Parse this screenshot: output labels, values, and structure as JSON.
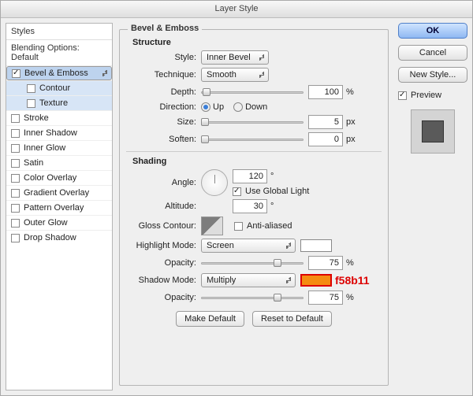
{
  "window": {
    "title": "Layer Style"
  },
  "left": {
    "header": "Styles",
    "blending": "Blending Options: Default",
    "items": [
      {
        "label": "Bevel & Emboss",
        "checked": true,
        "selected": true
      },
      {
        "label": "Contour",
        "checked": false,
        "child": true,
        "childsel": true
      },
      {
        "label": "Texture",
        "checked": false,
        "child": true,
        "childsel": true
      },
      {
        "label": "Stroke",
        "checked": false
      },
      {
        "label": "Inner Shadow",
        "checked": false
      },
      {
        "label": "Inner Glow",
        "checked": false
      },
      {
        "label": "Satin",
        "checked": false
      },
      {
        "label": "Color Overlay",
        "checked": false
      },
      {
        "label": "Gradient Overlay",
        "checked": false
      },
      {
        "label": "Pattern Overlay",
        "checked": false
      },
      {
        "label": "Outer Glow",
        "checked": false
      },
      {
        "label": "Drop Shadow",
        "checked": false
      }
    ]
  },
  "panel": {
    "title": "Bevel & Emboss",
    "structure": {
      "heading": "Structure",
      "style_label": "Style:",
      "style_value": "Inner Bevel",
      "technique_label": "Technique:",
      "technique_value": "Smooth",
      "depth_label": "Depth:",
      "depth_value": "100",
      "depth_unit": "%",
      "direction_label": "Direction:",
      "up_label": "Up",
      "down_label": "Down",
      "size_label": "Size:",
      "size_value": "5",
      "size_unit": "px",
      "soften_label": "Soften:",
      "soften_value": "0",
      "soften_unit": "px"
    },
    "shading": {
      "heading": "Shading",
      "angle_label": "Angle:",
      "angle_value": "120",
      "angle_unit": "°",
      "global_label": "Use Global Light",
      "altitude_label": "Altitude:",
      "altitude_value": "30",
      "altitude_unit": "°",
      "gloss_label": "Gloss Contour:",
      "aa_label": "Anti-aliased",
      "hmode_label": "Highlight Mode:",
      "hmode_value": "Screen",
      "hcolor": "#ffffff",
      "hopacity_label": "Opacity:",
      "hopacity_value": "75",
      "hopacity_unit": "%",
      "smode_label": "Shadow Mode:",
      "smode_value": "Multiply",
      "scolor": "#f58b11",
      "sopacity_label": "Opacity:",
      "sopacity_value": "75",
      "sopacity_unit": "%"
    },
    "make_default": "Make Default",
    "reset_default": "Reset to Default"
  },
  "right": {
    "ok": "OK",
    "cancel": "Cancel",
    "new_style": "New Style...",
    "preview_label": "Preview"
  },
  "annotation": "f58b11"
}
